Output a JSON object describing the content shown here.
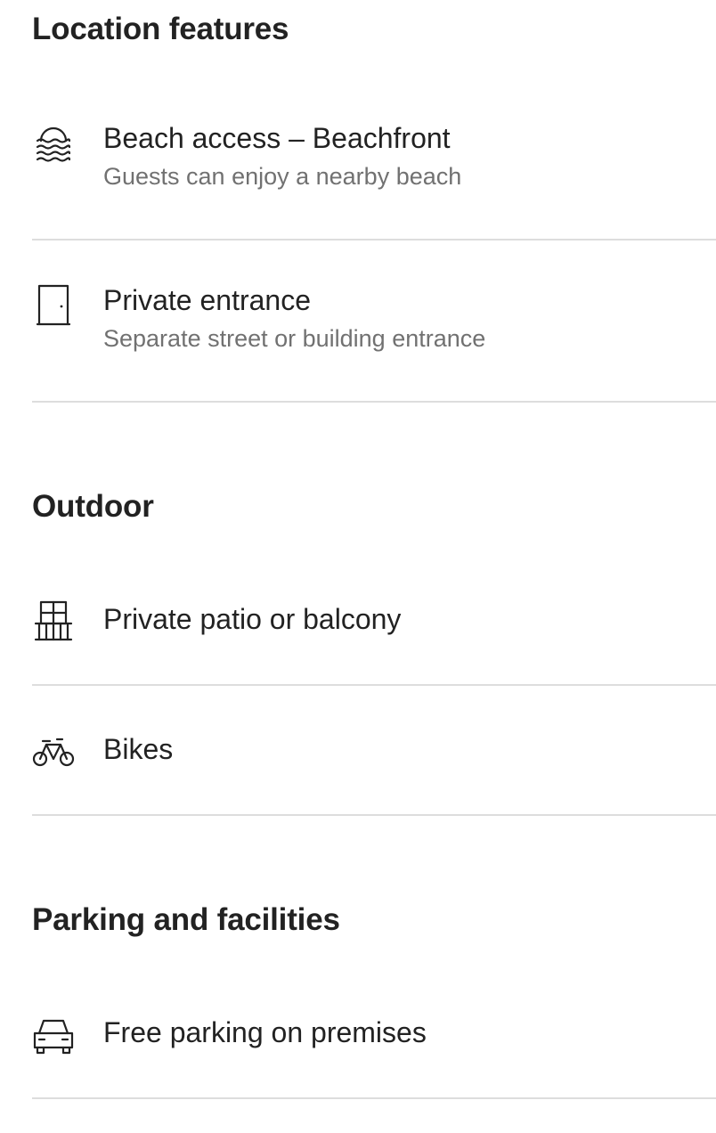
{
  "sections": [
    {
      "title": "Location features",
      "items": [
        {
          "label": "Beach access – Beachfront",
          "subtitle": "Guests can enjoy a nearby beach",
          "icon": "beach-icon"
        },
        {
          "label": "Private entrance",
          "subtitle": "Separate street or building entrance",
          "icon": "door-icon"
        }
      ]
    },
    {
      "title": "Outdoor",
      "items": [
        {
          "label": "Private patio or balcony",
          "icon": "balcony-icon"
        },
        {
          "label": "Bikes",
          "icon": "bike-icon"
        }
      ]
    },
    {
      "title": "Parking and facilities",
      "items": [
        {
          "label": "Free parking on premises",
          "icon": "car-icon"
        }
      ]
    }
  ],
  "colors": {
    "text": "#222222",
    "secondary_text": "#717171",
    "divider": "#dddddd"
  }
}
